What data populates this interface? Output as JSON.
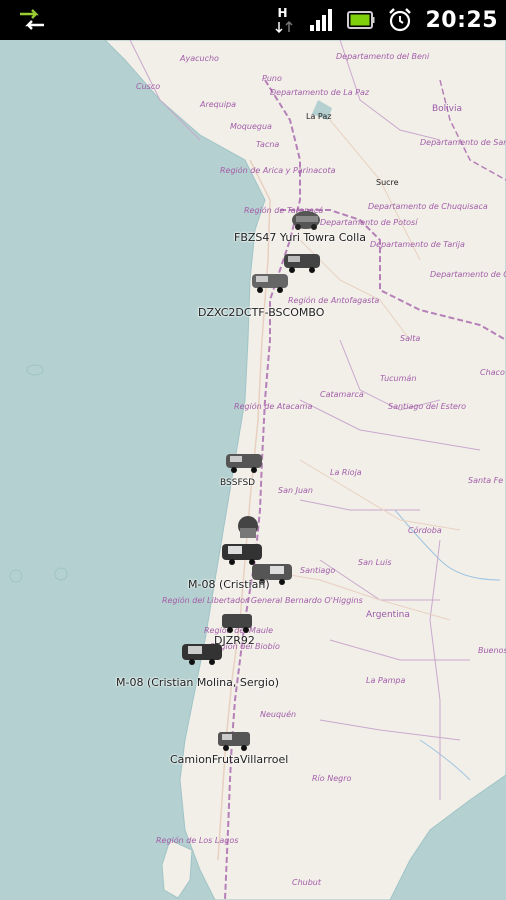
{
  "status_bar": {
    "time": "20:25",
    "network_letter": "H"
  },
  "map": {
    "regions": [
      "Ayacucho",
      "Departamento del Beni",
      "Puno",
      "Cusco",
      "Departamento de La Paz",
      "Arequipa",
      "Moquegua",
      "Bolivia",
      "Tacna",
      "Departamento de Santa Cruz",
      "Región de Arica y Parinacota",
      "Departamento de Chuquisaca",
      "Región de Tarapacá",
      "Departamento de Potosí",
      "Departamento de Tarija",
      "Departamento de Oruro",
      "Región de Antofagasta",
      "Salta",
      "Tucumán",
      "Chaco",
      "Región de Atacama",
      "Catamarca",
      "Santiago del Estero",
      "La Rioja",
      "Santa Fe",
      "San Juan",
      "Córdoba",
      "San Luis",
      "Santiago",
      "Región del Libertador General Bernardo O'Higgins",
      "Argentina",
      "Región del Maule",
      "Buenos Aires",
      "Región del Biobío",
      "La Pampa",
      "Neuquén",
      "Río Negro",
      "Región de Los Lagos",
      "Chubut"
    ],
    "cities": [
      "La Paz",
      "Sucre"
    ]
  },
  "vehicle_labels": {
    "fbz": "FBZS47 Yuri Towra Colla",
    "dzx": "DZXC2DCTF-BSCOMBO",
    "hidden_a": "DZXC2",
    "atacama": "BSSFSD",
    "m08_group": "M-08 (Cristian)",
    "djzr": "DJZR92",
    "m08b": "M-08 (Cristian Molina, Sergio)",
    "camion": "CamionFrutaVillarroel"
  }
}
